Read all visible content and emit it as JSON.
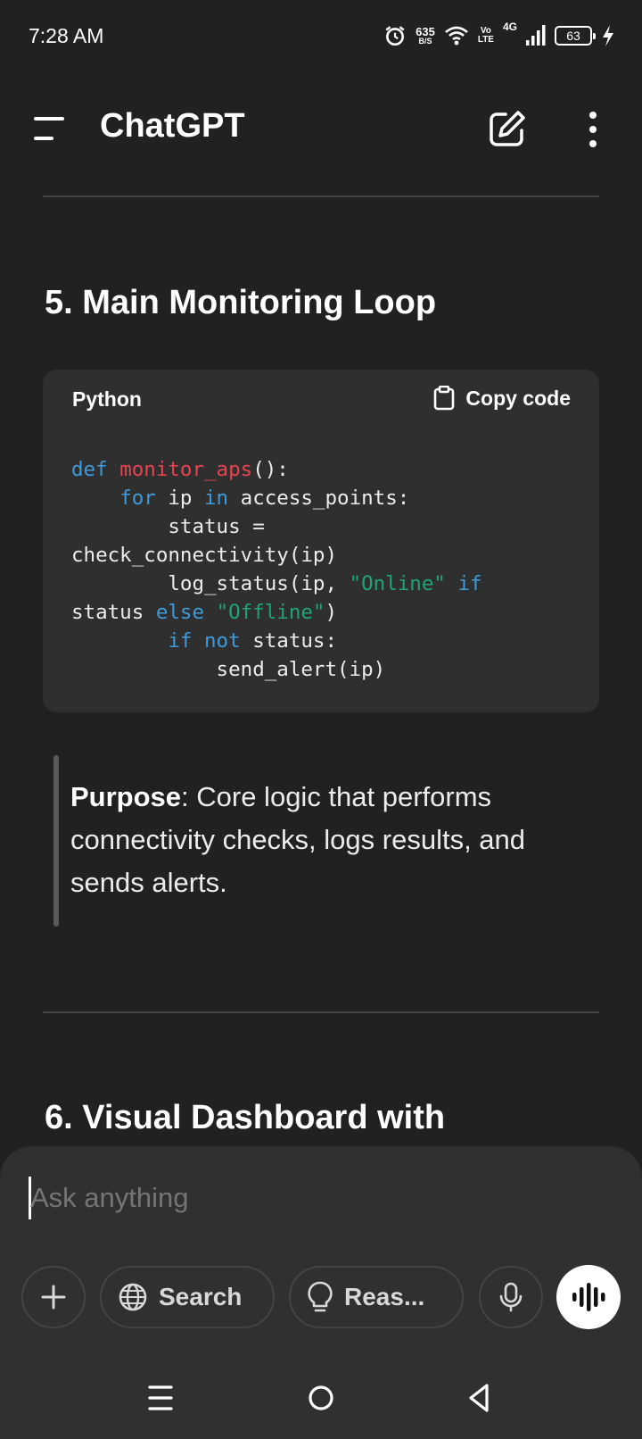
{
  "status_bar": {
    "time": "7:28 AM",
    "speed_value": "635",
    "speed_unit": "B/S",
    "volte_top": "Vo",
    "volte_bottom": "LTE",
    "network": "4G",
    "battery": "63"
  },
  "app_bar": {
    "title": "ChatGPT",
    "icons": [
      "menu-icon",
      "new-chat-icon",
      "more-icon"
    ]
  },
  "content": {
    "section5_heading": "5. Main Monitoring Loop",
    "code_block": {
      "language": "Python",
      "copy_label": "Copy code",
      "lines": [
        "def monitor_aps():",
        "    for ip in access_points:",
        "        status =",
        "check_connectivity(ip)",
        "        log_status(ip, \"Online\" if",
        "status else \"Offline\")",
        "        if not status:",
        "            send_alert(ip)"
      ]
    },
    "purpose_label": "Purpose",
    "purpose_text": ": Core logic that performs connectivity checks, logs results, and sends alerts.",
    "section6_heading": "6. Visual Dashboard with"
  },
  "composer": {
    "placeholder": "Ask anything",
    "search_label": "Search",
    "reason_label": "Reas...",
    "icons": [
      "plus-icon",
      "globe-icon",
      "bulb-icon",
      "mic-icon",
      "voice-waveform-icon"
    ]
  },
  "nav_bar": {
    "icons": [
      "recents-icon",
      "home-icon",
      "back-icon"
    ]
  },
  "colors": {
    "background": "#212121",
    "code_background": "#2f2f2f",
    "keyword": "#3d9bdc",
    "function": "#e8434f",
    "string": "#1ea37a"
  }
}
